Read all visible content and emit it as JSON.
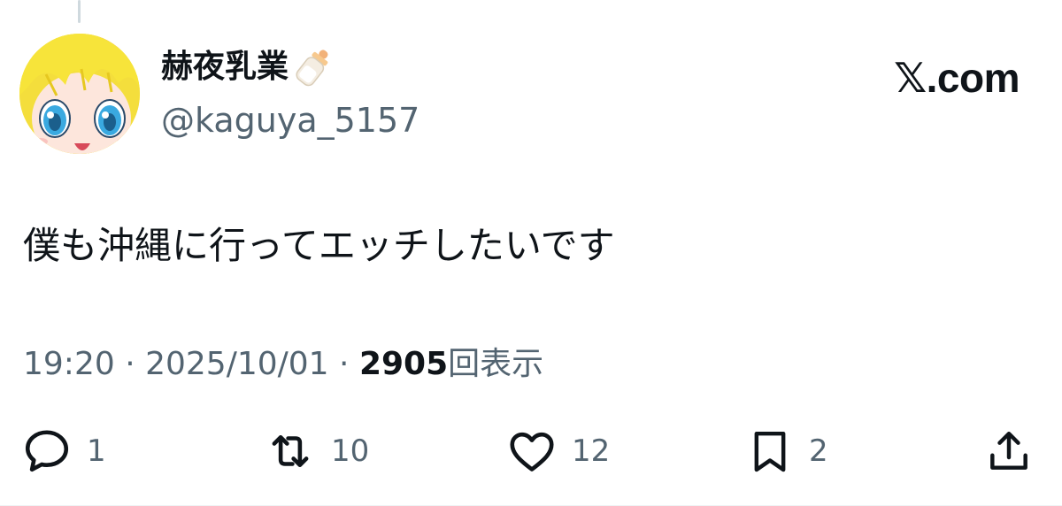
{
  "post": {
    "display_name": "赫夜乳業",
    "name_emoji": "baby-bottle-icon",
    "handle": "@kaguya_5157",
    "brand": "𝕏.com",
    "text": "僕も沖縄に行ってエッチしたいです",
    "time": "19:20",
    "separator": " · ",
    "date": "2025/10/01",
    "views_count": "2905",
    "views_label": "回表示"
  },
  "actions": {
    "reply": {
      "icon": "reply-icon",
      "count": "1"
    },
    "repost": {
      "icon": "repost-icon",
      "count": "10"
    },
    "like": {
      "icon": "heart-icon",
      "count": "12"
    },
    "bookmark": {
      "icon": "bookmark-icon",
      "count": "2"
    },
    "share": {
      "icon": "share-icon"
    }
  },
  "colors": {
    "text_primary": "#0f1419",
    "text_secondary": "#536471",
    "avatar_hair": "#f7e43a",
    "avatar_eyes": "#3aa9e0"
  }
}
